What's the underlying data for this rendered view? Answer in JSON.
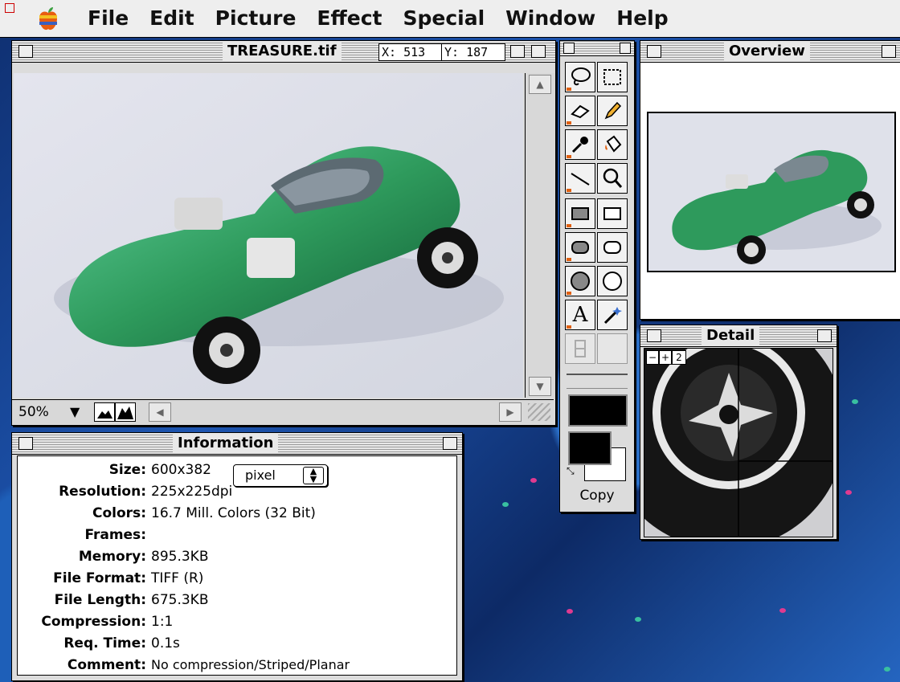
{
  "menubar": {
    "items": [
      "File",
      "Edit",
      "Picture",
      "Effect",
      "Special",
      "Window",
      "Help"
    ]
  },
  "image_window": {
    "title": "TREASURE.tif",
    "x_readout": "X: 513",
    "y_readout": "Y: 187",
    "zoom": "50%"
  },
  "information": {
    "title": "Information",
    "unit_popup": "pixel",
    "rows": [
      {
        "label": "Size",
        "value": "600x382"
      },
      {
        "label": "Resolution",
        "value": "225x225dpi"
      },
      {
        "label": "Colors",
        "value": "16.7 Mill. Colors (32 Bit)"
      },
      {
        "label": "Frames",
        "value": ""
      },
      {
        "label": "Memory",
        "value": "895.3KB"
      },
      {
        "label": "File Format",
        "value": "TIFF (R)"
      },
      {
        "label": "File Length",
        "value": "675.3KB"
      },
      {
        "label": "Compression",
        "value": "1:1"
      },
      {
        "label": "Req. Time",
        "value": "0.1s"
      },
      {
        "label": "Comment",
        "value": "No compression/Striped/Planar"
      }
    ]
  },
  "toolbox": {
    "tools": [
      "lasso-icon",
      "marquee-icon",
      "eraser-icon",
      "pencil-icon",
      "eyedropper-icon",
      "paint-bucket-icon",
      "line-icon",
      "magnifier-icon",
      "filled-rect-icon",
      "rect-icon",
      "filled-rounded-rect-icon",
      "rounded-rect-icon",
      "filled-oval-icon",
      "oval-icon",
      "text-icon",
      "magic-wand-icon"
    ],
    "text_tool_glyph": "A",
    "mode_label": "Copy",
    "foreground_color": "#000000",
    "background_color": "#ffffff"
  },
  "overview": {
    "title": "Overview"
  },
  "detail": {
    "title": "Detail",
    "zoom_minus": "−",
    "zoom_plus": "+",
    "zoom_level": "2"
  },
  "colors": {
    "car_green": "#2e9a5c",
    "desktop_blue": "#1d55b0",
    "accent_orange": "#e06010"
  }
}
